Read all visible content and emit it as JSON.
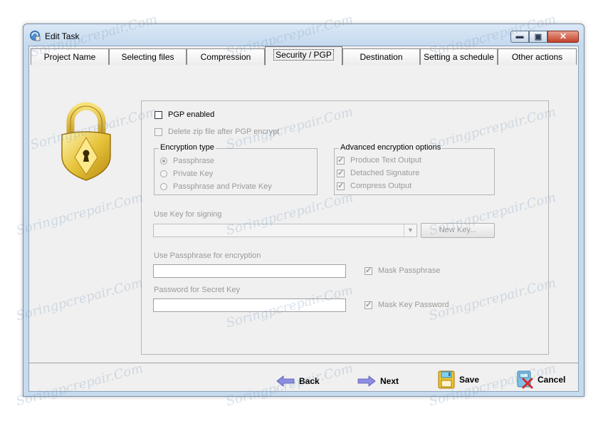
{
  "window": {
    "title": "Edit Task"
  },
  "tabs": [
    {
      "label": "Project Name"
    },
    {
      "label": "Selecting files"
    },
    {
      "label": "Compression"
    },
    {
      "label": "Security / PGP"
    },
    {
      "label": "Destination"
    },
    {
      "label": "Setting a schedule"
    },
    {
      "label": "Other actions"
    }
  ],
  "security": {
    "pgp_enabled": "PGP enabled",
    "delete_zip": "Delete zip file after PGP encrypt",
    "encryption_type": {
      "label": "Encryption type",
      "options": [
        "Passphrase",
        "Private Key",
        "Passphrase and Private Key"
      ],
      "selected": "Passphrase"
    },
    "advanced": {
      "label": "Advanced encryption options",
      "options": [
        "Produce Text Output",
        "Detached Signature",
        "Compress Output"
      ]
    },
    "use_key_label": "Use Key for signing",
    "new_key_button": "New Key...",
    "passphrase_label": "Use Passphrase for encryption",
    "mask_passphrase": "Mask Passphrase",
    "secret_key_label": "Password for Secret Key",
    "mask_key_password": "Mask Key Password"
  },
  "footer": {
    "back": "Back",
    "next": "Next",
    "save": "Save",
    "cancel": "Cancel"
  },
  "watermark": "Soringpcrepair.Com"
}
